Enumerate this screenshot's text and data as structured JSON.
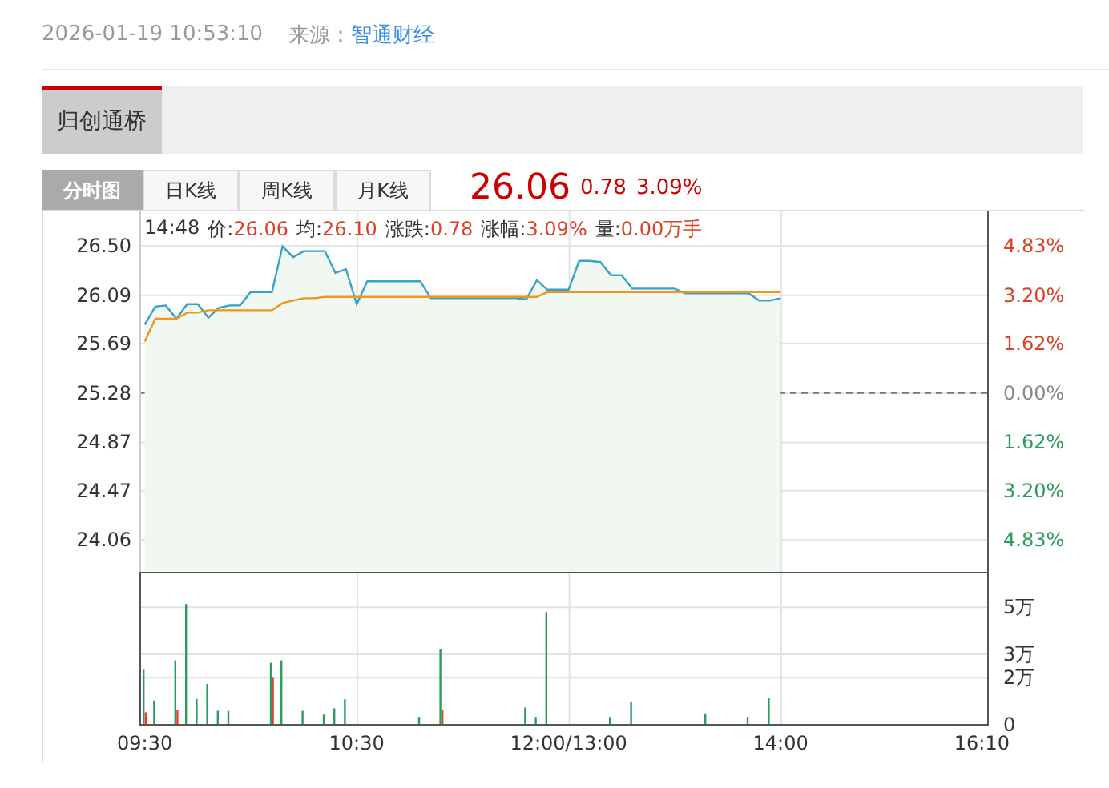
{
  "header": {
    "datetime": "2026-01-19 10:53:10",
    "source_label": "来源：",
    "source": "智通财经"
  },
  "stock_tabs": [
    {
      "label": "归创通桥",
      "selected": true
    }
  ],
  "chart_tabs": [
    {
      "label": "分时图",
      "selected": true
    },
    {
      "label": "日K线",
      "selected": false
    },
    {
      "label": "周K线",
      "selected": false
    },
    {
      "label": "月K线",
      "selected": false
    }
  ],
  "quote": {
    "price": "26.06",
    "change": "0.78",
    "change_pct": "3.09%"
  },
  "info": [
    {
      "label": "14:48"
    },
    {
      "label": "价:",
      "value": "26.06"
    },
    {
      "label": "均:",
      "value": "26.10"
    },
    {
      "label": "涨跌:",
      "value": "0.78"
    },
    {
      "label": "涨幅:",
      "value": "3.09%"
    },
    {
      "label": "量:",
      "value": "0.00万手"
    }
  ],
  "price_chart": {
    "percent_ticks": [
      {
        "label": "4.83%",
        "kind": "up"
      },
      {
        "label": "3.20%",
        "kind": "up"
      },
      {
        "label": "1.62%",
        "kind": "up"
      },
      {
        "label": "0.00%",
        "kind": "flat"
      },
      {
        "label": "1.62%",
        "kind": "down"
      },
      {
        "label": "3.20%",
        "kind": "down"
      },
      {
        "label": "4.83%",
        "kind": "down"
      }
    ],
    "chart_data": {
      "type": "line",
      "grid": true,
      "ref_lines": [
        {
          "axis": "y",
          "value": 25.28
        }
      ],
      "ylim": [
        23.79,
        26.78
      ],
      "yticks": [
        {
          "value": 26.5,
          "label": "26.50"
        },
        {
          "value": 26.09,
          "label": "26.09"
        },
        {
          "value": 25.69,
          "label": "25.69"
        },
        {
          "value": 25.28,
          "label": "25.28"
        },
        {
          "value": 24.87,
          "label": "24.87"
        },
        {
          "value": 24.47,
          "label": "24.47"
        },
        {
          "value": 24.06,
          "label": "24.06"
        }
      ],
      "categories": [
        null,
        null,
        null,
        null,
        null,
        null,
        null,
        null,
        null,
        null,
        null,
        null,
        null,
        null,
        null,
        null,
        null,
        null,
        null,
        null,
        null,
        null,
        null,
        null,
        null,
        null,
        null,
        null,
        null,
        null,
        null,
        null,
        null,
        null,
        null,
        null,
        null,
        null,
        null,
        null,
        null,
        null,
        null,
        null,
        null,
        null,
        null,
        null,
        null,
        null,
        null,
        null,
        null,
        null,
        null,
        null,
        null,
        null,
        null,
        null,
        null,
        null,
        null,
        null,
        null,
        null,
        null,
        null,
        null,
        null,
        null,
        null,
        null,
        null,
        null,
        null,
        null,
        null,
        null,
        null
      ],
      "series": [
        {
          "color": "#33a3c9",
          "values": [
            25.84,
            25.99,
            26.0,
            25.89,
            26.01,
            26.01,
            25.9,
            25.98,
            26.0,
            26.0,
            26.11,
            26.11,
            26.11,
            26.49,
            26.4,
            26.45,
            26.45,
            26.45,
            26.27,
            26.3,
            26.01,
            26.2,
            26.2,
            26.2,
            26.2,
            26.2,
            26.2,
            26.06,
            26.06,
            26.06,
            26.06,
            26.06,
            26.06,
            26.06,
            26.06,
            26.06,
            26.05,
            26.21,
            26.13,
            26.13,
            26.13,
            26.37,
            26.37,
            26.36,
            26.25,
            26.25,
            26.14,
            26.14,
            26.14,
            26.14,
            26.14,
            26.1,
            26.1,
            26.1,
            26.1,
            26.1,
            26.1,
            26.1,
            26.04,
            26.04,
            26.06,
            null,
            null,
            null,
            null,
            null,
            null,
            null,
            null,
            null,
            null,
            null,
            null,
            null,
            null,
            null,
            null,
            null,
            null,
            null
          ]
        },
        {
          "color": "#f0961c",
          "values": [
            25.7,
            25.89,
            25.89,
            25.89,
            25.94,
            25.94,
            25.96,
            25.96,
            25.96,
            25.96,
            25.96,
            25.96,
            25.96,
            26.02,
            26.04,
            26.06,
            26.06,
            26.07,
            26.07,
            26.07,
            26.07,
            26.07,
            26.07,
            26.07,
            26.07,
            26.07,
            26.07,
            26.07,
            26.07,
            26.07,
            26.07,
            26.07,
            26.07,
            26.07,
            26.07,
            26.07,
            26.07,
            26.07,
            26.11,
            26.11,
            26.11,
            26.11,
            26.11,
            26.11,
            26.11,
            26.11,
            26.11,
            26.11,
            26.11,
            26.11,
            26.11,
            26.11,
            26.11,
            26.11,
            26.11,
            26.11,
            26.11,
            26.11,
            26.11,
            26.11,
            26.11,
            null,
            null,
            null,
            null,
            null,
            null,
            null,
            null,
            null,
            null,
            null,
            null,
            null,
            null,
            null,
            null,
            null,
            null,
            null
          ]
        }
      ]
    }
  },
  "volume_chart": {
    "chart_data": {
      "type": "bar",
      "grid": true,
      "ylim": [
        0,
        6.4
      ],
      "categories": [
        "09:30",
        null,
        null,
        null,
        null,
        null,
        null,
        null,
        null,
        null,
        null,
        null,
        null,
        null,
        null,
        null,
        null,
        null,
        null,
        null,
        "10:30",
        null,
        null,
        null,
        null,
        null,
        null,
        null,
        null,
        null,
        null,
        null,
        null,
        null,
        null,
        null,
        null,
        null,
        null,
        null,
        "12:00/13:00",
        null,
        null,
        null,
        null,
        null,
        null,
        null,
        null,
        null,
        null,
        null,
        null,
        null,
        null,
        null,
        null,
        null,
        null,
        null,
        "14:00",
        null,
        null,
        null,
        null,
        null,
        null,
        null,
        null,
        null,
        null,
        null,
        null,
        null,
        null,
        null,
        null,
        null,
        null,
        "16:10"
      ],
      "yticks": [
        {
          "value": 0,
          "label": "0"
        },
        {
          "value": 2,
          "label": "2万"
        },
        {
          "value": 3,
          "label": "3万"
        },
        {
          "value": 5,
          "label": "5万"
        }
      ],
      "series": [
        {
          "color": "#2e9a5c",
          "values": [
            2.3,
            1.0,
            null,
            2.7,
            5.1,
            1.06,
            1.7,
            0.56,
            0.56,
            null,
            null,
            null,
            2.6,
            2.7,
            null,
            0.56,
            null,
            0.4,
            0.67,
            1.05,
            null,
            null,
            null,
            null,
            null,
            null,
            0.3,
            null,
            3.2,
            null,
            null,
            null,
            null,
            null,
            null,
            null,
            0.7,
            0.3,
            4.76,
            null,
            null,
            null,
            null,
            null,
            0.3,
            null,
            0.95,
            null,
            null,
            null,
            null,
            null,
            null,
            0.45,
            null,
            null,
            null,
            0.3,
            null,
            1.1,
            null,
            null,
            null,
            null,
            null,
            null,
            null,
            null,
            null,
            null,
            null,
            null,
            null,
            null,
            null,
            null,
            null,
            null,
            null,
            null
          ]
        },
        {
          "color": "#e0402a",
          "values": [
            0.5,
            null,
            null,
            0.6,
            null,
            null,
            null,
            null,
            null,
            null,
            null,
            null,
            1.96,
            null,
            null,
            null,
            null,
            null,
            null,
            null,
            null,
            null,
            null,
            null,
            null,
            null,
            null,
            null,
            0.6,
            null,
            null,
            null,
            null,
            null,
            null,
            null,
            null,
            null,
            null,
            null,
            null,
            null,
            null,
            null,
            null,
            null,
            null,
            null,
            null,
            null,
            null,
            null,
            null,
            null,
            null,
            null,
            null,
            null,
            null,
            null,
            null,
            null,
            null,
            null,
            null,
            null,
            null,
            null,
            null,
            null,
            null,
            null,
            null,
            null,
            null,
            null,
            null,
            null,
            null,
            null
          ]
        }
      ]
    }
  }
}
